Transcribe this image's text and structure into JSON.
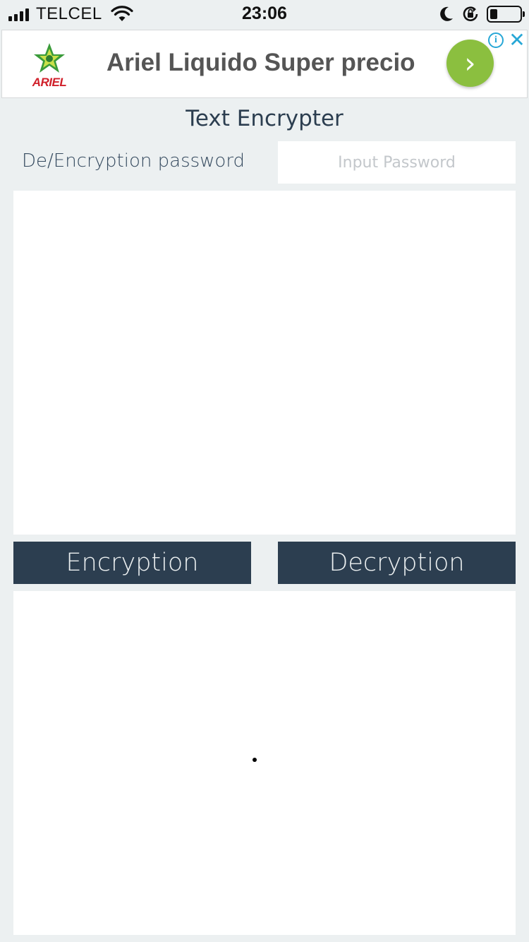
{
  "status_bar": {
    "carrier": "TELCEL",
    "time": "23:06",
    "icons": [
      "signal-icon",
      "wifi-icon",
      "moon-icon",
      "rotation-lock-icon",
      "battery-icon"
    ],
    "battery_level": 0.2
  },
  "ad": {
    "brand": "ARIEL",
    "headline": "Ariel Liquido Super precio",
    "go_glyph": "›",
    "info_glyph": "i",
    "close_glyph": "✕",
    "accent_color": "#8bbf3f",
    "info_color": "#27a7d6"
  },
  "app": {
    "title": "Text Encrypter",
    "password_label": "De/Encryption password",
    "password_placeholder": "Input Password",
    "password_value": "",
    "input_text": "",
    "encrypt_label": "Encryption",
    "decrypt_label": "Decryption",
    "output_text": "",
    "theme": {
      "background": "#ecf0f1",
      "primary": "#2c3e50"
    }
  }
}
